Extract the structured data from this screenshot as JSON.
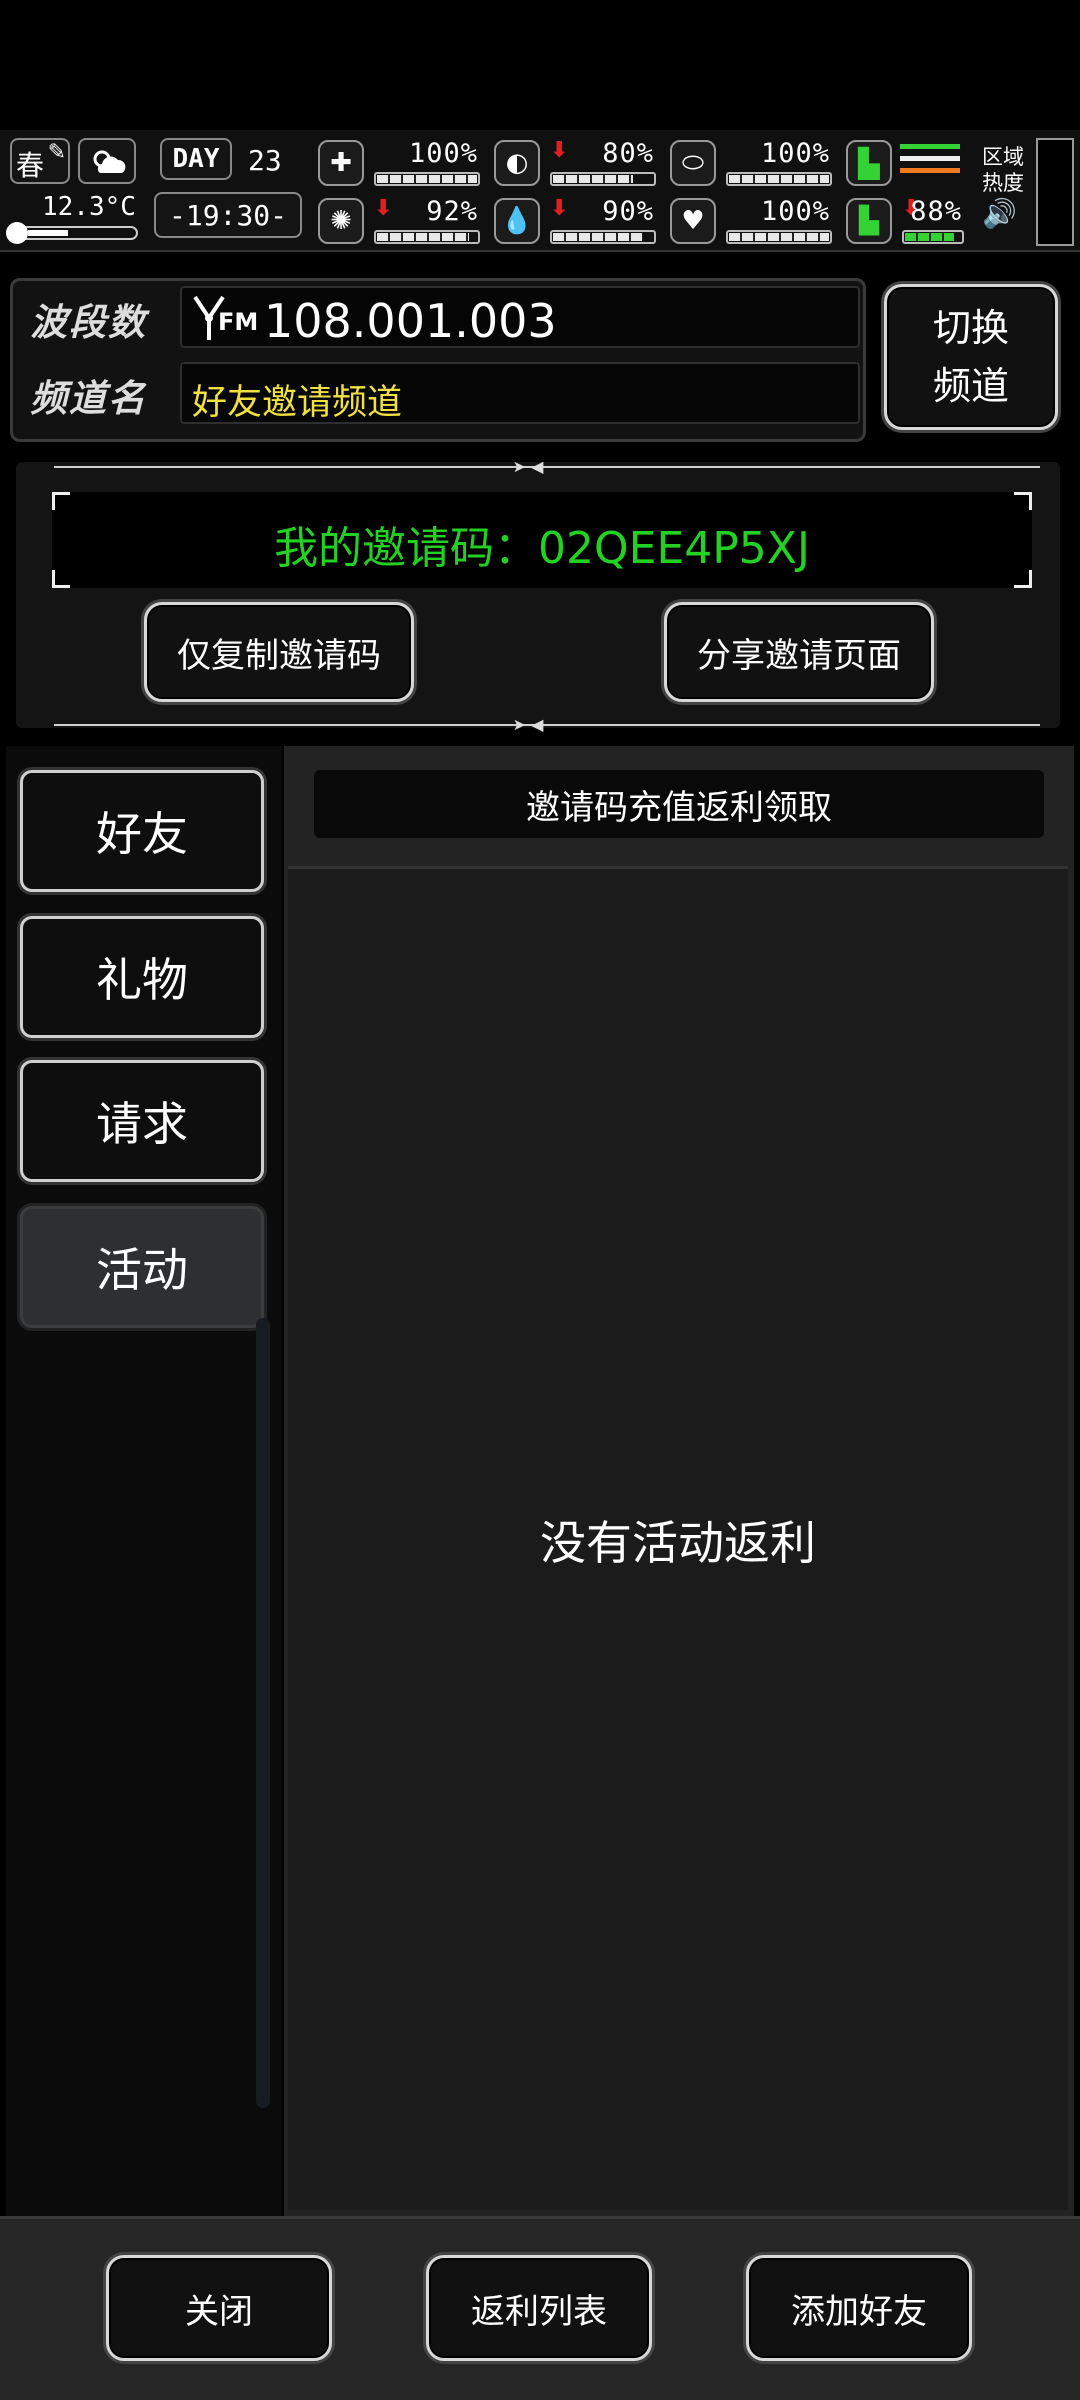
{
  "status": {
    "season": "春",
    "temperature": "12.3°C",
    "day_label": "DAY",
    "day_number": "23",
    "time": "-19:30-",
    "stats_top": [
      {
        "icon": "medkit-icon",
        "pct": "100%",
        "fill": 1.0,
        "down": false
      },
      {
        "icon": "stomach-icon",
        "pct": "80%",
        "fill": 0.8,
        "down": true
      },
      {
        "icon": "pill-icon",
        "pct": "100%",
        "fill": 1.0,
        "down": false
      }
    ],
    "stats_bottom": [
      {
        "icon": "brain-icon",
        "pct": "92%",
        "fill": 0.92,
        "down": true
      },
      {
        "icon": "water-drop-icon",
        "pct": "90%",
        "fill": 0.9,
        "down": true
      },
      {
        "icon": "heart-icon",
        "pct": "100%",
        "fill": 1.0,
        "down": false
      },
      {
        "icon": "stamina-icon",
        "pct": "88%",
        "fill": 0.88,
        "down": true
      }
    ],
    "zone_heat_label_1": "区域",
    "zone_heat_label_2": "热度"
  },
  "channel": {
    "band_label": "波段数",
    "band_fm": "FM",
    "band_value": "108.001.003",
    "name_label": "频道名",
    "name_value": "好友邀请频道",
    "switch_line1": "切换",
    "switch_line2": "频道"
  },
  "invite": {
    "code_text": "我的邀请码：02QEE4P5XJ",
    "copy_button": "仅复制邀请码",
    "share_button": "分享邀请页面"
  },
  "tabs": [
    {
      "label": "好友",
      "active": false
    },
    {
      "label": "礼物",
      "active": false
    },
    {
      "label": "请求",
      "active": false
    },
    {
      "label": "活动",
      "active": true
    }
  ],
  "content": {
    "header_button": "邀请码充值返利领取",
    "empty_message": "没有活动返利"
  },
  "bottom": {
    "close": "关闭",
    "rebate_list": "返利列表",
    "add_friend": "添加好友"
  },
  "colors": {
    "invite_code_green": "#22d122",
    "channel_name_yellow": "#f0e040",
    "stat_down_arrow": "#e02020"
  }
}
